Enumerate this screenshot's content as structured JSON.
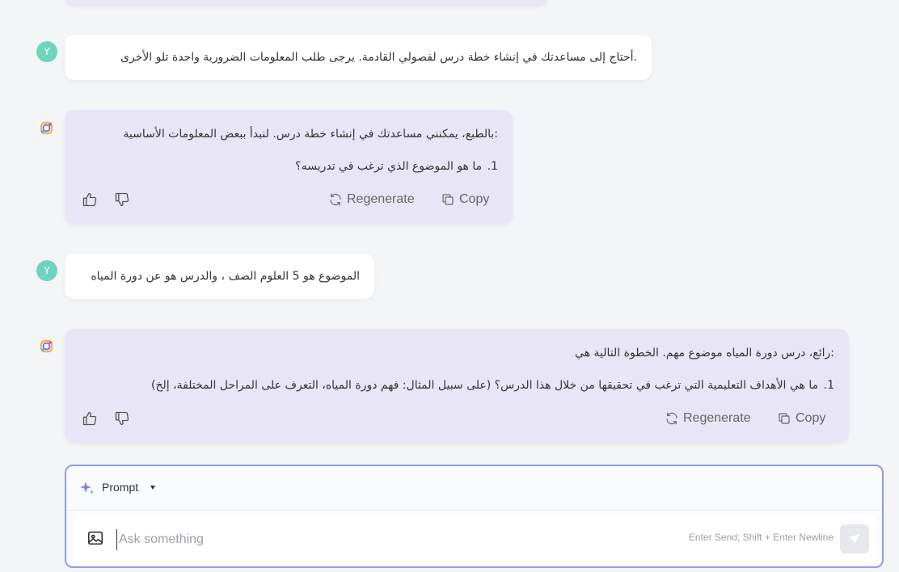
{
  "user_avatar_letter": "Y",
  "messages": [
    {
      "role": "user",
      "text": ".أحتاج إلى مساعدتك في إنشاء خطة درس لفصولي القادمة. يرجى طلب المعلومات الضرورية واحدة تلو الأخرى"
    },
    {
      "role": "assistant",
      "intro": ":بالطبع، يمكنني مساعدتك في إنشاء خطة درس. لنبدأ ببعض المعلومات الأساسية",
      "item_number": "1.",
      "item_text": "ما هو الموضوع الذي ترغب في تدريسه؟"
    },
    {
      "role": "user",
      "text": "الموضوع هو 5 العلوم الصف ، والدرس هو عن دورة المياه"
    },
    {
      "role": "assistant",
      "intro": ":رائع، درس دورة المياه موضوع مهم. الخطوة التالية هي",
      "item_number": "1.",
      "item_text": "ما هي الأهداف التعليمية التي ترغب في تحقيقها من خلال هذا الدرس؟ (على سبيل المثال: فهم دورة المياه، التعرف على المراحل المختلفة، إلخ)"
    }
  ],
  "actions": {
    "regenerate": "Regenerate",
    "copy": "Copy"
  },
  "composer": {
    "mode_label": "Prompt",
    "placeholder": "Ask something",
    "hint": "Enter Send; Shift + Enter Newline"
  }
}
